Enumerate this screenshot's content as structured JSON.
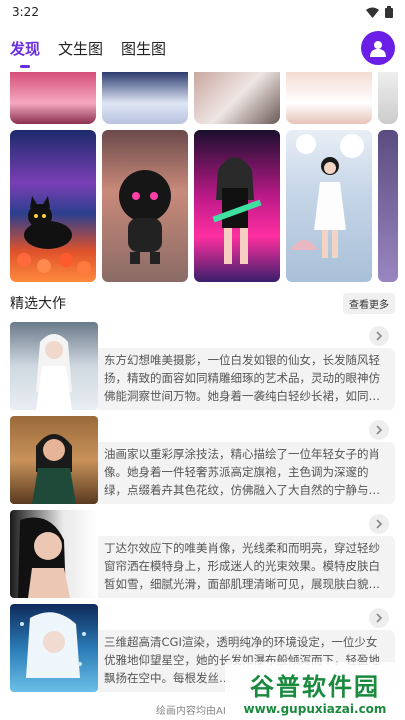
{
  "status": {
    "time": "3:22"
  },
  "tabs": [
    {
      "label": "发现",
      "active": true
    },
    {
      "label": "文生图",
      "active": false
    },
    {
      "label": "图生图",
      "active": false
    }
  ],
  "section": {
    "title": "精选大作",
    "more_label": "查看更多"
  },
  "cards": [
    {
      "desc": "东方幻想唯美摄影，一位白发如银的仙女，长发随风轻扬，精致的面容如同精雕细琢的艺术品，灵动的眼神仿佛能洞察世间万物。她身着一袭纯白轻纱长裙，如同…"
    },
    {
      "desc": "油画家以重彩厚涂技法，精心描绘了一位年轻女子的肖像。她身着一件轻奢苏派高定旗袍，主色调为深邃的绿，点缀着卉其色花纹，仿佛融入了大自然的宁静与…"
    },
    {
      "desc": "丁达尔效应下的唯美肖像，光线柔和而明亮，穿过轻纱窗帘洒在模特身上，形成迷人的光束效果。模特皮肤白皙如雪，细腻光滑，面部肌理清晰可见，展现肤白貌…"
    },
    {
      "desc": "三维超高清CGI渲染，透明纯净的环境设定，一位少女优雅地仰望星空，她的长发如瀑布般倾泻而下，轻盈地飘扬在空中。每根发丝…"
    }
  ],
  "footer": {
    "text": "绘画内容均由AI"
  },
  "watermark": {
    "main": "谷普软件园",
    "sub": "www.gupuxiazai.com"
  },
  "colors": {
    "accent": "#6a2ce0",
    "avatar_bg": "#6a1ee6"
  }
}
